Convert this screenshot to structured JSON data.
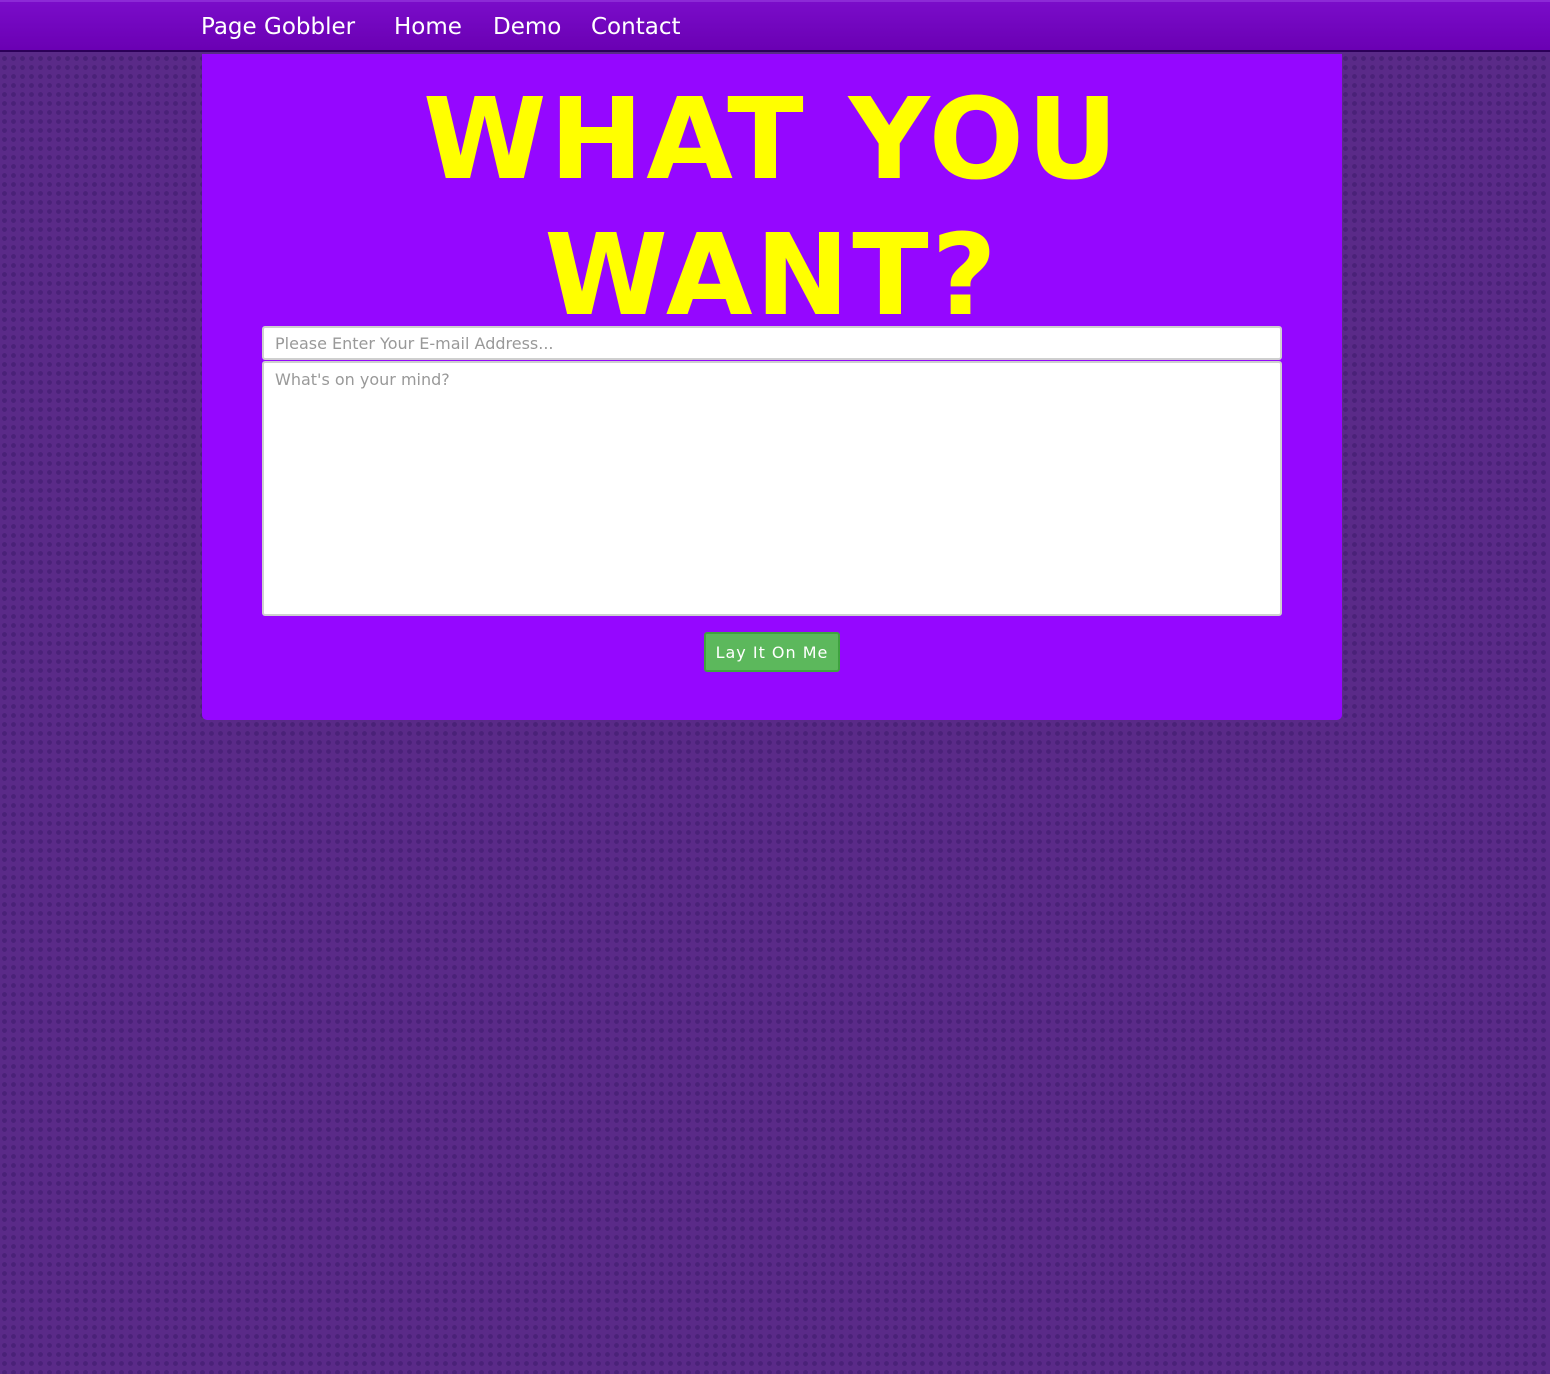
{
  "navbar": {
    "brand": "Page Gobbler",
    "links": [
      {
        "label": "Home"
      },
      {
        "label": "Demo"
      },
      {
        "label": "Contact"
      }
    ]
  },
  "main": {
    "headline_line1": "WHAT YOU",
    "headline_line2": "WANT?",
    "form": {
      "email_placeholder": "Please Enter Your E-mail Address...",
      "email_value": "",
      "message_placeholder": "What's on your mind?",
      "message_value": "",
      "submit_label": "Lay It On Me"
    }
  },
  "colors": {
    "navbar": "#6a00b3",
    "panel": "#9507ff",
    "headline": "#ffff00",
    "submit_button": "#5cb85c",
    "page_background": "#5a2a88"
  }
}
